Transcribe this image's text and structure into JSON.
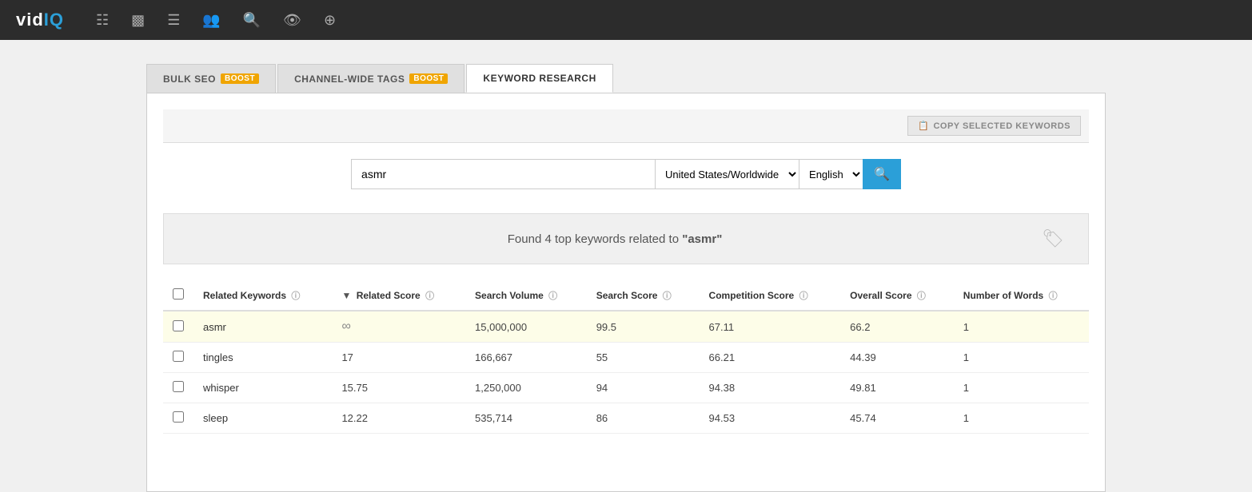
{
  "app": {
    "logo": {
      "vid": "vid",
      "iq": "IQ"
    }
  },
  "nav": {
    "icons": [
      {
        "name": "bar-chart-icon",
        "symbol": "📊"
      },
      {
        "name": "video-icon",
        "symbol": "🎬"
      },
      {
        "name": "list-icon",
        "symbol": "☰"
      },
      {
        "name": "users-icon",
        "symbol": "👥"
      },
      {
        "name": "search-icon",
        "symbol": "🔍"
      },
      {
        "name": "eye-icon",
        "symbol": "👁"
      },
      {
        "name": "plus-icon",
        "symbol": "⊕"
      }
    ]
  },
  "tabs": [
    {
      "id": "bulk-seo",
      "label": "BULK SEO",
      "badge": "BOOST",
      "active": false
    },
    {
      "id": "channel-wide-tags",
      "label": "CHANNEL-WIDE TAGS",
      "badge": "BOOST",
      "active": false
    },
    {
      "id": "keyword-research",
      "label": "KEYWORD RESEARCH",
      "badge": null,
      "active": true
    }
  ],
  "toolbar": {
    "copy_keywords_label": "COPY SELECTED KEYWORDS"
  },
  "search": {
    "query": "asmr",
    "region_options": [
      {
        "value": "us-worldwide",
        "label": "United States/Worldwide"
      }
    ],
    "region_selected": "United States/Worldwide",
    "language_options": [
      {
        "value": "en",
        "label": "English"
      }
    ],
    "language_selected": "English",
    "button_label": "🔍"
  },
  "results": {
    "banner_text": "Found 4 top keywords related to “asmr”"
  },
  "table": {
    "columns": [
      {
        "id": "checkbox",
        "label": ""
      },
      {
        "id": "keyword",
        "label": "Related Keywords"
      },
      {
        "id": "related_score",
        "label": "Related Score",
        "sortable": true
      },
      {
        "id": "search_volume",
        "label": "Search Volume"
      },
      {
        "id": "search_score",
        "label": "Search Score"
      },
      {
        "id": "competition_score",
        "label": "Competition Score"
      },
      {
        "id": "overall_score",
        "label": "Overall Score"
      },
      {
        "id": "num_words",
        "label": "Number of Words"
      }
    ],
    "rows": [
      {
        "keyword": "asmr",
        "related_score": "∞",
        "search_volume": "15,000,000",
        "search_score": "99.5",
        "competition_score": "67.11",
        "overall_score": "66.2",
        "num_words": "1",
        "highlighted": true
      },
      {
        "keyword": "tingles",
        "related_score": "17",
        "search_volume": "166,667",
        "search_score": "55",
        "competition_score": "66.21",
        "overall_score": "44.39",
        "num_words": "1",
        "highlighted": false
      },
      {
        "keyword": "whisper",
        "related_score": "15.75",
        "search_volume": "1,250,000",
        "search_score": "94",
        "competition_score": "94.38",
        "overall_score": "49.81",
        "num_words": "1",
        "highlighted": false
      },
      {
        "keyword": "sleep",
        "related_score": "12.22",
        "search_volume": "535,714",
        "search_score": "86",
        "competition_score": "94.53",
        "overall_score": "45.74",
        "num_words": "1",
        "highlighted": false
      }
    ]
  }
}
